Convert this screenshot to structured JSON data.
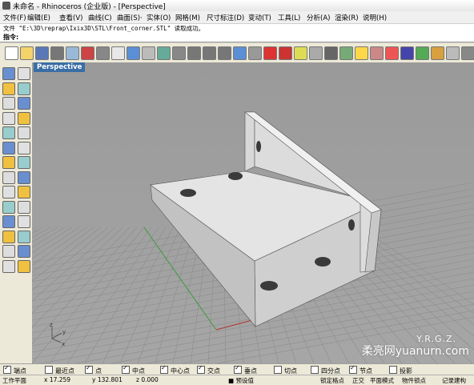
{
  "window": {
    "title": "未命名 - Rhinoceros (企业版) - [Perspective]"
  },
  "menu": {
    "items": [
      "文件(F)",
      "编辑(E)",
      "查看(V)",
      "曲线(C)",
      "曲面(S)·",
      "实体(O)",
      "网格(M)",
      "尺寸标注(D)",
      "变动(T)",
      "工具(L)",
      "分析(A)",
      "渲染(R)",
      "说明(H)"
    ]
  },
  "command": {
    "history": "文件 \"E:\\3D\\reprap\\Ixix3D\\STL\\Front_corner.STL\" 读取成功。",
    "prompt": "指令:"
  },
  "toolbar": {
    "icons": [
      "new-icon",
      "open-icon",
      "save-icon",
      "print-icon",
      "import-icon",
      "cut-icon",
      "copy-icon",
      "paste-icon",
      "undo-icon",
      "pan-icon",
      "rotate-view-icon",
      "zoom-icon",
      "zoom-window-icon",
      "zoom-extents-icon",
      "zoom-selected-icon",
      "undo-view-icon",
      "four-view-icon",
      "grid-icon",
      "car-icon",
      "light-icon",
      "cplane-icon",
      "point-icon",
      "layer-icon",
      "lightbulb-icon",
      "lock-icon",
      "color-icon",
      "render-icon",
      "sphere-icon",
      "material-icon",
      "options-icon",
      "more-icon"
    ]
  },
  "sidebar": {
    "icons": [
      "select-icon",
      "point-icon",
      "polyline-icon",
      "curve-icon",
      "circle-icon",
      "arc-icon",
      "rectangle-icon",
      "polygon-icon",
      "ellipse-icon",
      "fillet-icon",
      "surface-icon",
      "extrude-icon",
      "box-icon",
      "sphere-icon",
      "solid-tools-icon",
      "boolean-icon",
      "transform-icon",
      "array-icon",
      "group-icon",
      "edit-points-icon",
      "trim-icon",
      "split-icon",
      "join-icon",
      "explode-icon",
      "text-icon",
      "dimension-icon",
      "analyze-icon",
      "mesh-icon"
    ]
  },
  "viewport": {
    "label": "Perspective",
    "axis_labels": {
      "z": "z",
      "y": "y",
      "x": "x"
    },
    "watermark_brand": "Y.R.G.Z.",
    "watermark_site": "柔亮网yuanurn.com"
  },
  "osnap": {
    "items": [
      {
        "label": "端点",
        "checked": true
      },
      {
        "label": "最近点",
        "checked": false
      },
      {
        "label": "点",
        "checked": true
      },
      {
        "label": "中点",
        "checked": true
      },
      {
        "label": "中心点",
        "checked": true
      },
      {
        "label": "交点",
        "checked": true
      },
      {
        "label": "垂点",
        "checked": true
      },
      {
        "label": "切点",
        "checked": false
      },
      {
        "label": "四分点",
        "checked": false
      },
      {
        "label": "节点",
        "checked": true
      },
      {
        "label": "投影",
        "checked": false
      }
    ]
  },
  "status": {
    "cplane": "工作平面",
    "x": "x 17.259",
    "y": "y 132.801",
    "z": "z 0.000",
    "layer": "■ 预设值",
    "grid_snap": "锁定格点",
    "ortho": "正交",
    "planar": "平面模式",
    "osnap": "物件锁点",
    "record": "记录建构"
  }
}
